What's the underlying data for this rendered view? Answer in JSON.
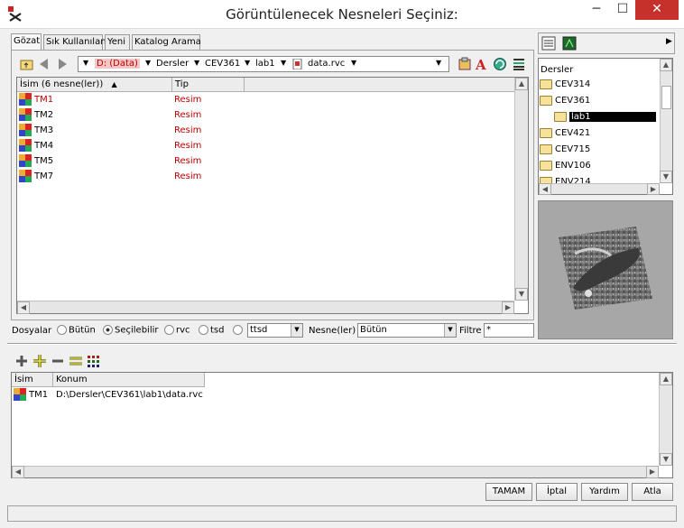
{
  "window": {
    "title": "Görüntülenecek Nesneleri Seçiniz:",
    "min": "─",
    "max": "☐",
    "close": "✕"
  },
  "tabs": [
    "Gözat",
    "Sık Kullanılan",
    "Yeni",
    "Katalog Arama"
  ],
  "path": {
    "drive": "D: (Data)",
    "crumbs": [
      "Dersler",
      "CEV361",
      "lab1"
    ],
    "file": "data.rvc"
  },
  "list": {
    "columns": [
      "İsim  (6 nesne(ler))",
      "Tip"
    ],
    "rows": [
      {
        "name": "TM1",
        "type": "Resim"
      },
      {
        "name": "TM2",
        "type": "Resim"
      },
      {
        "name": "TM3",
        "type": "Resim"
      },
      {
        "name": "TM4",
        "type": "Resim"
      },
      {
        "name": "TM5",
        "type": "Resim"
      },
      {
        "name": "TM7",
        "type": "Resim"
      }
    ]
  },
  "tree": {
    "root": "Dersler",
    "folders": [
      "CEV314",
      "CEV361",
      "lab1",
      "CEV421",
      "CEV715",
      "ENV106",
      "ENV214"
    ]
  },
  "filter": {
    "files_label": "Dosyalar",
    "options": [
      "Bütün",
      "Seçilebilir",
      "rvc",
      "tsd",
      ""
    ],
    "type_value": "ttsd",
    "objects_label": "Nesne(ler)",
    "objects_value": "Bütün",
    "filter_label": "Filtre",
    "filter_value": "*"
  },
  "selected": {
    "columns": [
      "İsim",
      "Konum"
    ],
    "rows": [
      {
        "name": "TM1",
        "location": "D:\\Dersler\\CEV361\\lab1\\data.rvc"
      }
    ]
  },
  "buttons": {
    "ok": "TAMAM",
    "cancel": "İptal",
    "help": "Yardım",
    "skip": "Atla"
  }
}
